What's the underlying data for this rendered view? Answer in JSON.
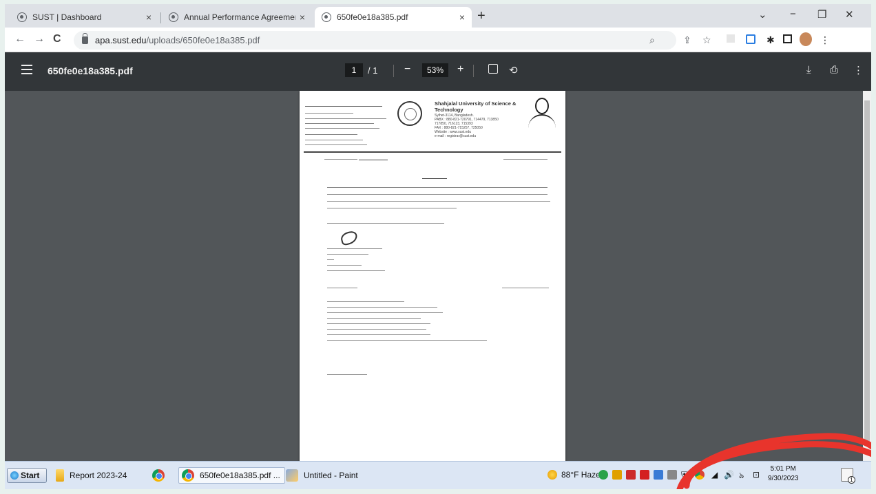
{
  "browser": {
    "tabs": [
      {
        "title": "SUST | Dashboard",
        "close": "×"
      },
      {
        "title": "Annual Performance Agreement",
        "close": "×"
      },
      {
        "title": "650fe0e18a385.pdf",
        "close": "×",
        "active": true
      }
    ],
    "new_tab": "+",
    "window_controls": {
      "menu": "⌄",
      "minimize": "−",
      "restore": "❐",
      "close": "✕"
    },
    "nav": {
      "back": "←",
      "forward": "→",
      "reload": "C"
    },
    "url": {
      "host": "apa.sust.edu",
      "path": "/uploads/650fe0e18a385.pdf"
    }
  },
  "pdf_viewer": {
    "title": "650fe0e18a385.pdf",
    "page_current": "1",
    "page_total": "/ 1",
    "zoom_out": "−",
    "zoom": "53%",
    "zoom_in": "+",
    "download": "⤓",
    "print": "⎙",
    "more": "⋮"
  },
  "document": {
    "university_name": "Shahjalal University of Science & Technology",
    "address_lines": [
      "Sylhet-3114, Bangladesh.",
      "PABX   : 880-821-720791, 714479, 713850",
      "             717850, 716123, 715393",
      "FAX     : 880-821-715257, 725050",
      "Website : www.sust.edu",
      "e-mail   : registrar@sust.edu"
    ]
  },
  "taskbar": {
    "start": "Start",
    "items": [
      {
        "label": "Report 2023-24"
      },
      {
        "label": ""
      },
      {
        "label": "650fe0e18a385.pdf ..."
      },
      {
        "label": "Untitled - Paint"
      }
    ],
    "weather": "88°F  Haze",
    "time": "5:01 PM",
    "date": "9/30/2023",
    "notification_count": "1"
  },
  "colors": {
    "pdf_toolbar": "#323639",
    "viewer_bg": "#525659",
    "annotation_red": "#e8342c",
    "taskbar": "#dce6f4"
  }
}
